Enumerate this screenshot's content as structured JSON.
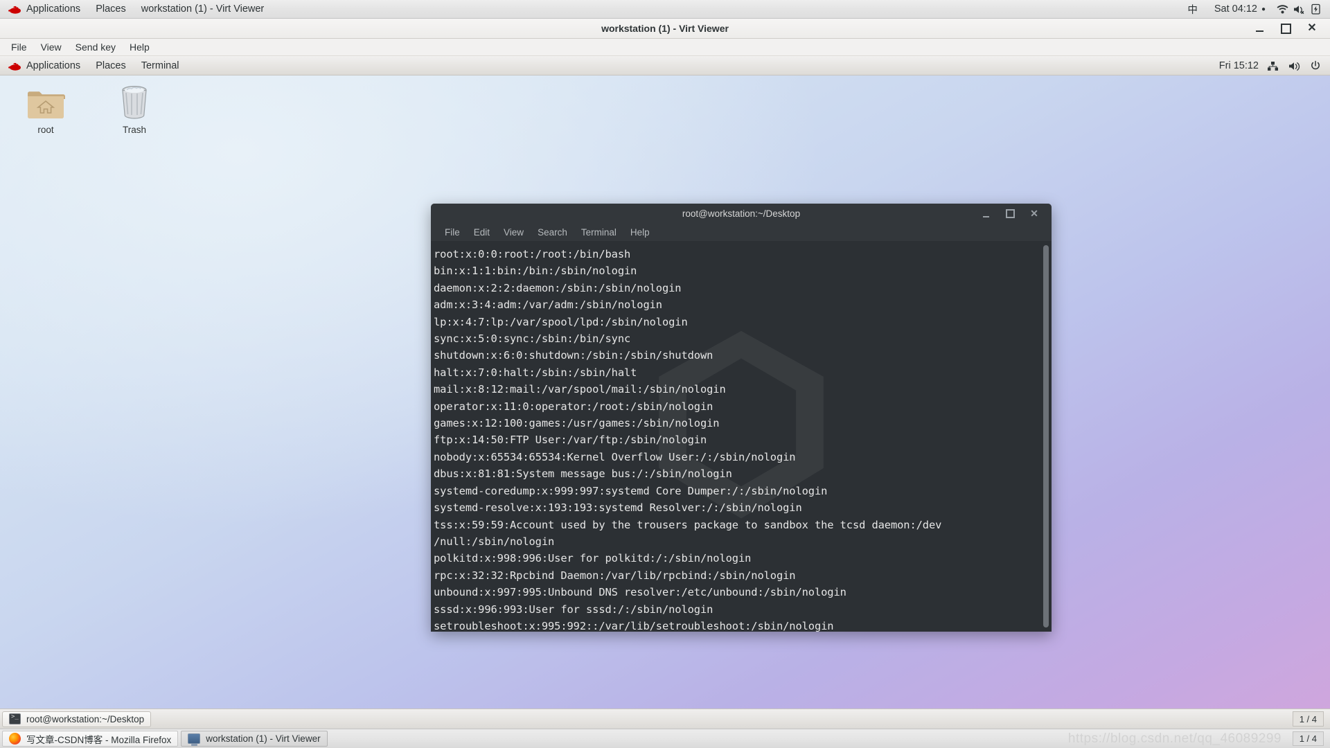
{
  "host_panel": {
    "logo": "redhat-logo",
    "items": [
      "Applications",
      "Places"
    ],
    "window_title": "workstation (1) - Virt Viewer",
    "input_method": "中",
    "clock": "Sat 04:12",
    "clock_dot": "●",
    "tray": [
      "wifi-icon",
      "volume-muted-icon",
      "battery-charging-icon"
    ]
  },
  "virt_viewer": {
    "title": "workstation (1) - Virt Viewer",
    "menu": [
      "File",
      "View",
      "Send key",
      "Help"
    ],
    "controls": [
      "minimize",
      "maximize",
      "close"
    ]
  },
  "guest_panel": {
    "logo": "redhat-logo",
    "items": [
      "Applications",
      "Places",
      "Terminal"
    ],
    "clock": "Fri 15:12",
    "tray": [
      "network-icon",
      "volume-icon",
      "power-icon"
    ]
  },
  "desktop": {
    "icons": [
      {
        "label": "root",
        "type": "home-folder"
      },
      {
        "label": "Trash",
        "type": "trash-can"
      }
    ]
  },
  "terminal": {
    "title": "root@workstation:~/Desktop",
    "menu": [
      "File",
      "Edit",
      "View",
      "Search",
      "Terminal",
      "Help"
    ],
    "controls": [
      "minimize",
      "maximize",
      "close"
    ],
    "lines": [
      "root:x:0:0:root:/root:/bin/bash",
      "bin:x:1:1:bin:/bin:/sbin/nologin",
      "daemon:x:2:2:daemon:/sbin:/sbin/nologin",
      "adm:x:3:4:adm:/var/adm:/sbin/nologin",
      "lp:x:4:7:lp:/var/spool/lpd:/sbin/nologin",
      "sync:x:5:0:sync:/sbin:/bin/sync",
      "shutdown:x:6:0:shutdown:/sbin:/sbin/shutdown",
      "halt:x:7:0:halt:/sbin:/sbin/halt",
      "mail:x:8:12:mail:/var/spool/mail:/sbin/nologin",
      "operator:x:11:0:operator:/root:/sbin/nologin",
      "games:x:12:100:games:/usr/games:/sbin/nologin",
      "ftp:x:14:50:FTP User:/var/ftp:/sbin/nologin",
      "nobody:x:65534:65534:Kernel Overflow User:/:/sbin/nologin",
      "dbus:x:81:81:System message bus:/:/sbin/nologin",
      "systemd-coredump:x:999:997:systemd Core Dumper:/:/sbin/nologin",
      "systemd-resolve:x:193:193:systemd Resolver:/:/sbin/nologin",
      "tss:x:59:59:Account used by the trousers package to sandbox the tcsd daemon:/dev",
      "/null:/sbin/nologin",
      "polkitd:x:998:996:User for polkitd:/:/sbin/nologin",
      "rpc:x:32:32:Rpcbind Daemon:/var/lib/rpcbind:/sbin/nologin",
      "unbound:x:997:995:Unbound DNS resolver:/etc/unbound:/sbin/nologin",
      "sssd:x:996:993:User for sssd:/:/sbin/nologin",
      "setroubleshoot:x:995:992::/var/lib/setroubleshoot:/sbin/nologin"
    ],
    "prompt": ":"
  },
  "guest_taskbar": {
    "task": "root@workstation:~/Desktop",
    "workspace": "1 / 4"
  },
  "host_taskbar": {
    "tasks": [
      {
        "label": "写文章-CSDN博客 - Mozilla Firefox",
        "icon": "firefox-icon",
        "active": false
      },
      {
        "label": "workstation (1) - Virt Viewer",
        "icon": "display-icon",
        "active": true
      }
    ],
    "workspace": "1 / 4",
    "watermark": "https://blog.csdn.net/qq_46089299"
  },
  "colors": {
    "terminal_bg": "#2c3034",
    "terminal_fg": "#e6e6e6",
    "panel_bg": "#e6e4e1",
    "redhat_red": "#cc0000"
  }
}
